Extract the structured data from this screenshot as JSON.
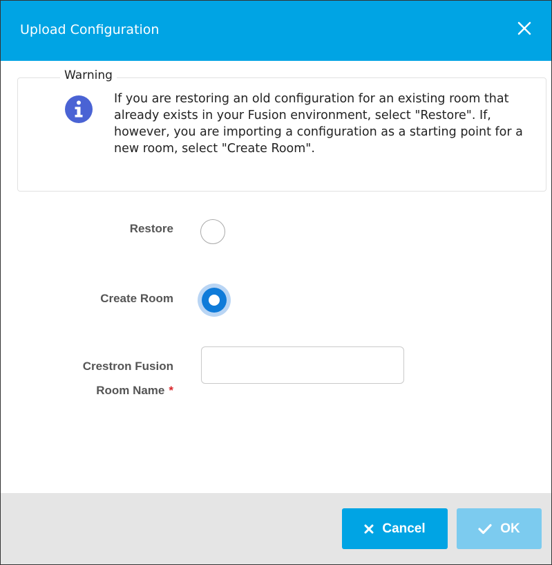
{
  "dialog": {
    "title": "Upload Configuration",
    "close_icon": "close-icon"
  },
  "warning": {
    "legend": "Warning",
    "icon": "info-icon",
    "message": "If you are restoring an old configuration for an existing room that already exists in your Fusion environment, select \"Restore\". If, however, you are importing a configuration as a starting point for a new room, select \"Create Room\"."
  },
  "options": {
    "restore_label": "Restore",
    "restore_selected": false,
    "create_room_label": "Create Room",
    "create_room_selected": true
  },
  "room_name": {
    "label_line1": "Crestron Fusion",
    "label_line2": "Room Name",
    "required_mark": "*",
    "value": "",
    "placeholder": ""
  },
  "footer": {
    "cancel_label": "Cancel",
    "cancel_icon": "x-icon",
    "ok_label": "OK",
    "ok_icon": "check-icon",
    "ok_enabled": false
  },
  "colors": {
    "header": "#00a4e4",
    "primary_button": "#00a4e4",
    "disabled_button": "#7ccbef",
    "radio_selected": "#0f7bd9",
    "info_icon": "#4a63d4",
    "required": "#d9252a"
  }
}
